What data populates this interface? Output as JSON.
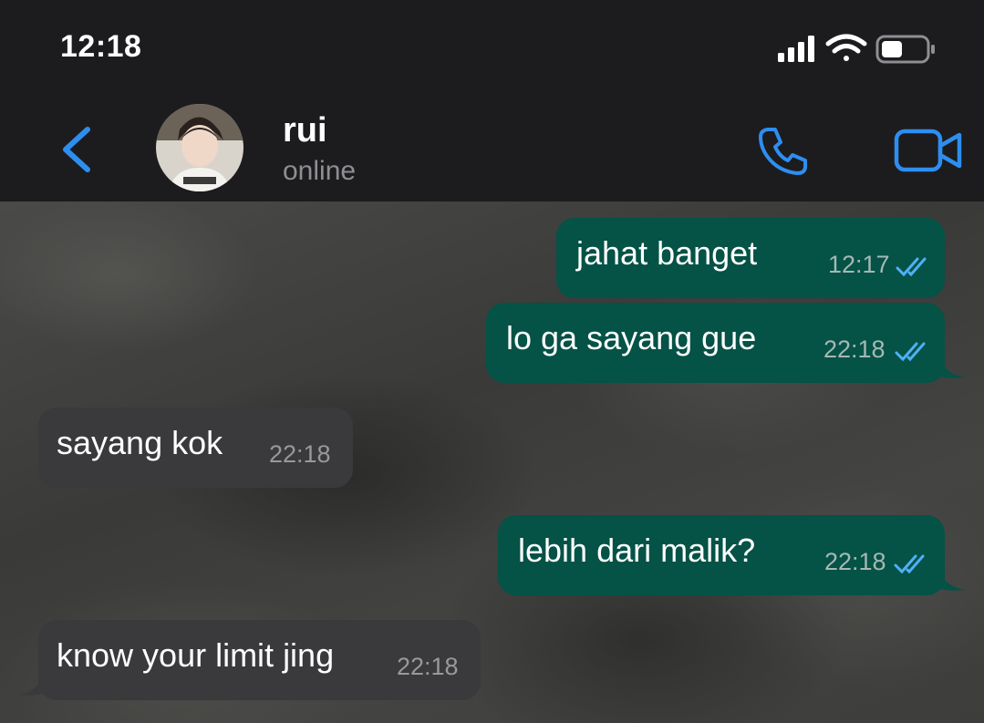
{
  "status_bar": {
    "time": "12:18",
    "icons": [
      "signal-icon",
      "wifi-icon",
      "battery-icon"
    ]
  },
  "header": {
    "contact_name": "rui",
    "contact_status": "online",
    "icons": [
      "back-chevron-icon",
      "avatar",
      "phone-icon",
      "video-camera-icon"
    ]
  },
  "colors": {
    "accent": "#2e8ef0",
    "outgoing_bubble": "#055246",
    "incoming_bubble": "#3a3a3c",
    "read_tick": "#4fb0f5"
  },
  "messages": [
    {
      "direction": "outgoing",
      "text": "jahat banget",
      "time": "12:17",
      "status": "read"
    },
    {
      "direction": "outgoing",
      "text": "lo ga sayang gue",
      "time": "22:18",
      "status": "read"
    },
    {
      "direction": "incoming",
      "text": "sayang kok",
      "time": "22:18"
    },
    {
      "direction": "outgoing",
      "text": "lebih dari malik?",
      "time": "22:18",
      "status": "read"
    },
    {
      "direction": "incoming",
      "text": "know your limit jing",
      "time": "22:18"
    }
  ]
}
